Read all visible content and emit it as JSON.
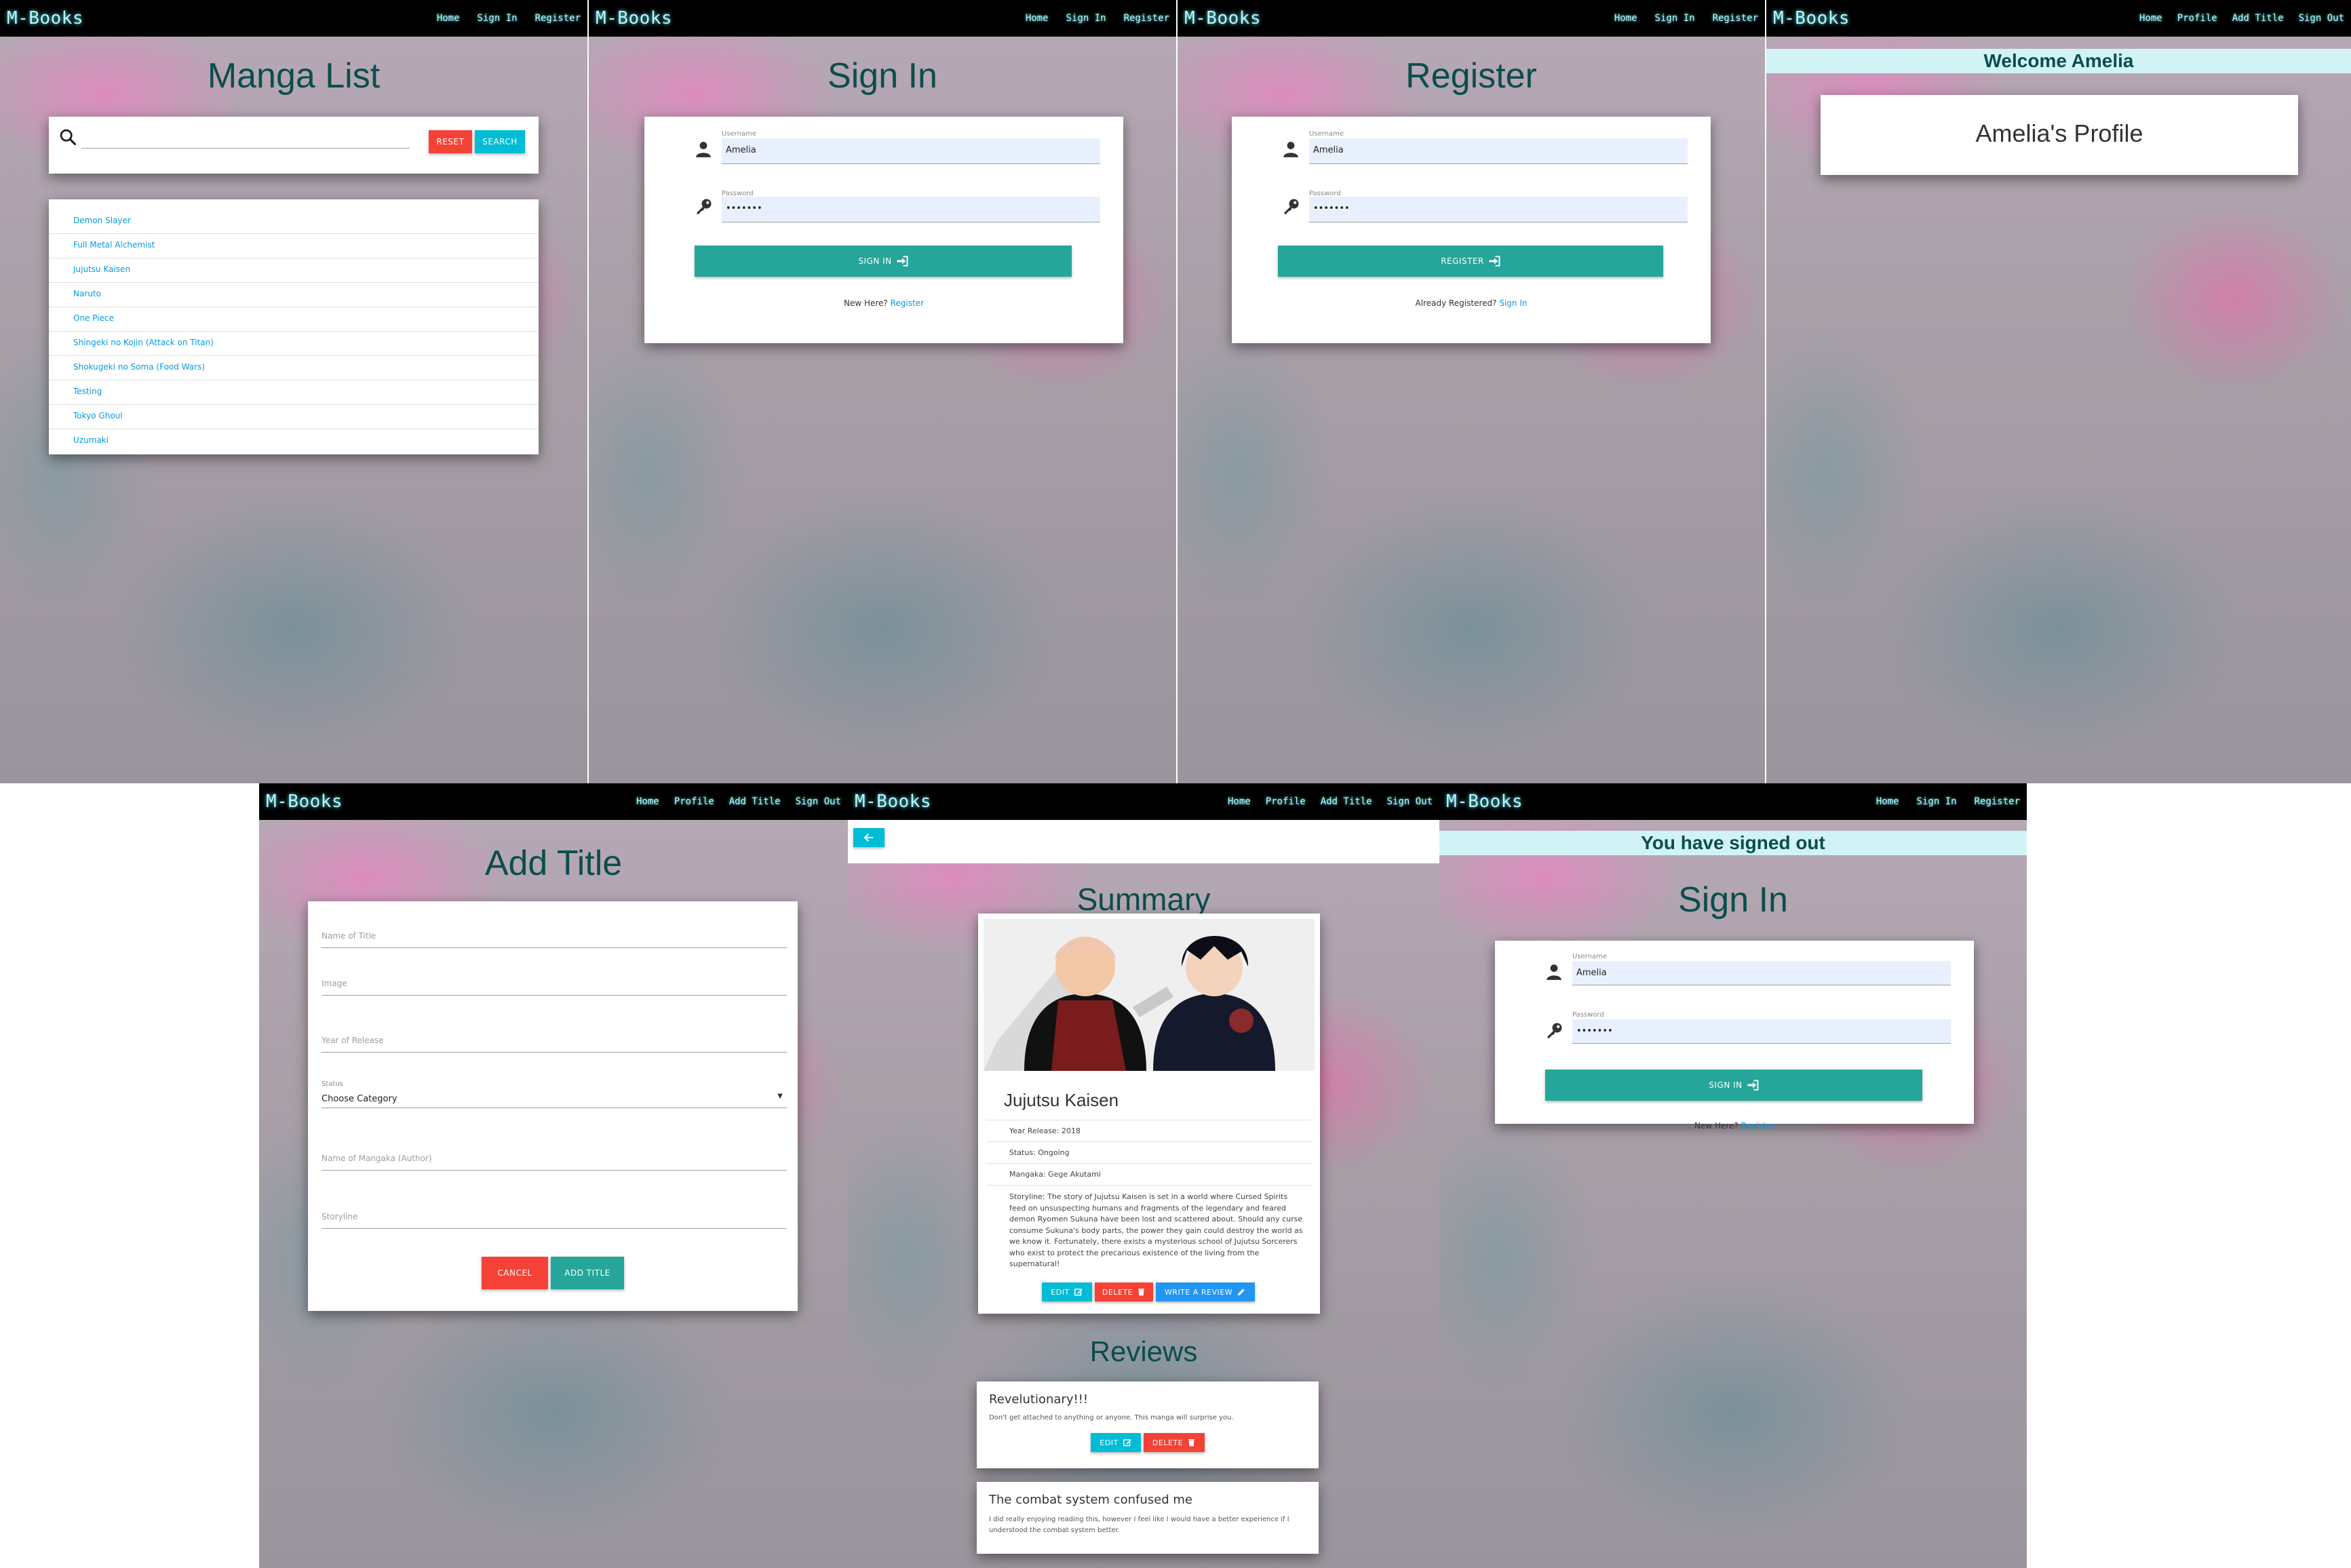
{
  "brand": "M-Books",
  "nav_guest": [
    "Home",
    "Sign In",
    "Register"
  ],
  "nav_user": [
    "Home",
    "Profile",
    "Add Title",
    "Sign Out"
  ],
  "manga_list": {
    "heading": "Manga List",
    "reset_label": "RESET",
    "search_label": "SEARCH",
    "items": [
      "Demon Slayer",
      "Full Metal Alchemist",
      "Jujutsu Kaisen",
      "Naruto",
      "One Piece",
      "Shingeki no Kojin (Attack on Titan)",
      "Shokugeki no Soma (Food Wars)",
      "Testing",
      "Tokyo Ghoul",
      "Uzumaki"
    ]
  },
  "sign_in": {
    "heading": "Sign In",
    "username_label": "Username",
    "username_value": "Amelia",
    "password_label": "Password",
    "password_value": "•••••••",
    "button_label": "SIGN IN",
    "footer_text": "New Here?",
    "footer_link": "Register"
  },
  "register": {
    "heading": "Register",
    "username_label": "Username",
    "username_value": "Amelia",
    "password_label": "Password",
    "password_value": "•••••••",
    "button_label": "REGISTER",
    "footer_text": "Already Registered?",
    "footer_link": "Sign In"
  },
  "profile": {
    "flash": "Welcome Amelia",
    "title": "Amelia's Profile"
  },
  "add_title": {
    "heading": "Add Title",
    "name_label": "Name of Title",
    "image_label": "Image",
    "year_label": "Year of Release",
    "status_label": "Status",
    "status_value": "Choose Category",
    "author_label": "Name of Mangaka (Author)",
    "storyline_label": "Storyline",
    "cancel_label": "CANCEL",
    "add_label": "ADD TITLE"
  },
  "summary": {
    "heading": "Summary",
    "title": "Jujutsu Kaisen",
    "year": "Year Release: 2018",
    "status": "Status: Ongoing",
    "mangaka": "Mangaka: Gege Akutami",
    "storyline": "Storyline: The story of Jujutsu Kaisen is set in a world where Cursed Spirits feed on unsuspecting humans and fragments of the legendary and feared demon Ryomen Sukuna have been lost and scattered about. Should any curse consume Sukuna's body parts, the power they gain could destroy the world as we know it. Fortunately, there exists a mysterious school of Jujutsu Sorcerers who exist to protect the precarious existence of the living from the supernatural!",
    "edit_label": "EDIT",
    "delete_label": "DELETE",
    "review_label": "WRITE A REVIEW",
    "reviews_heading": "Reviews",
    "reviews": [
      {
        "title": "Revelutionary!!!",
        "body": "Don't get attached to anything or anyone. This manga will surprise you."
      },
      {
        "title": "The combat system confused me",
        "body": "I did really enjoying reading this, however I feel like I would have a better experience if I understood the combat system better."
      }
    ]
  },
  "signed_out": {
    "flash": "You have signed out",
    "heading": "Sign In",
    "username_label": "Username",
    "username_value": "Amelia",
    "password_label": "Password",
    "password_value": "•••••••",
    "button_label": "SIGN IN",
    "footer_text": "New Here?",
    "footer_link": "Register"
  }
}
